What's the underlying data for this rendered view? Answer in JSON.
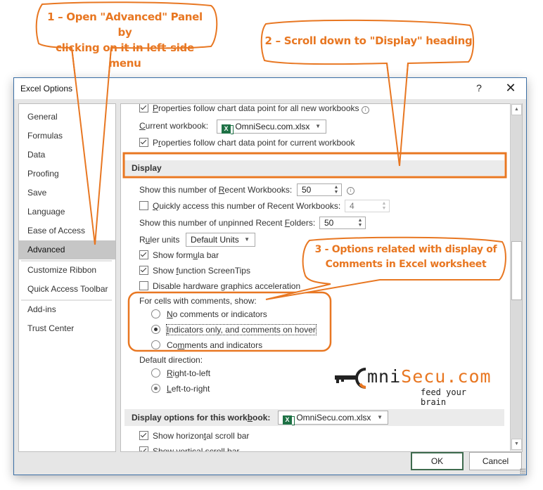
{
  "annotations": {
    "step1": [
      "1 – Open \"Advanced\" Panel by",
      "clicking on it in left-side menu"
    ],
    "step2": "2 – Scroll down to \"Display\" heading",
    "step3": [
      "3 - Options related with display of",
      "Comments in Excel worksheet"
    ],
    "color": "#e87722"
  },
  "dialog": {
    "title": "Excel Options",
    "help_label": "?",
    "close_label": "✕"
  },
  "sidebar": {
    "items": [
      {
        "label": "General"
      },
      {
        "label": "Formulas"
      },
      {
        "label": "Data"
      },
      {
        "label": "Proofing"
      },
      {
        "label": "Save"
      },
      {
        "label": "Language"
      },
      {
        "label": "Ease of Access"
      },
      {
        "label": "Advanced",
        "selected": true
      },
      {
        "label": "Customize Ribbon"
      },
      {
        "label": "Quick Access Toolbar"
      },
      {
        "label": "Add-ins"
      },
      {
        "label": "Trust Center"
      }
    ]
  },
  "content": {
    "chart_props_all": {
      "pre": "",
      "u": "P",
      "post": "roperties follow chart data point for all new workbooks",
      "checked": true
    },
    "current_workbook": {
      "label_u": "C",
      "label_post": "urrent workbook:",
      "value": "OmniSecu.com.xlsx"
    },
    "chart_props_current": {
      "pre": "P",
      "u": "r",
      "post": "operties follow chart data point for current workbook",
      "checked": true
    },
    "display_heading": "Display",
    "recent_workbooks": {
      "pre": "Show this number of ",
      "u": "R",
      "post": "ecent Workbooks:",
      "value": "50"
    },
    "quick_access": {
      "u": "Q",
      "post": "uickly access this number of Recent Workbooks:",
      "value": "4",
      "checked": false
    },
    "recent_folders": {
      "pre": "Show this number of unpinned Recent ",
      "u": "F",
      "post": "olders:",
      "value": "50"
    },
    "ruler_units": {
      "pre": "R",
      "u": "u",
      "post": "ler units",
      "value": "Default Units"
    },
    "formula_bar": {
      "pre": "Show form",
      "u": "u",
      "post": "la bar",
      "checked": true
    },
    "screentips": {
      "pre": "Show ",
      "u": "f",
      "post": "unction ScreenTips",
      "checked": true
    },
    "hw_accel": {
      "pre": "Disable hardware ",
      "u": "g",
      "post": "raphics acceleration",
      "checked": false
    },
    "comments_label": "For cells with comments, show:",
    "comments_options": [
      {
        "pre": "",
        "u": "N",
        "post": "o comments or indicators",
        "selected": false
      },
      {
        "pre": "",
        "u": "I",
        "post": "ndicators only, and comments on hover",
        "selected": true
      },
      {
        "pre": "Co",
        "u": "m",
        "post": "ments and indicators",
        "selected": false
      }
    ],
    "direction_label": "Default direction:",
    "direction_options": [
      {
        "u": "R",
        "post": "ight-to-left",
        "selected": false
      },
      {
        "u": "L",
        "post": "eft-to-right",
        "selected": true
      }
    ],
    "workbook_display_heading": {
      "pre": "Display options for this work",
      "u": "b",
      "post": "ook:",
      "value": "OmniSecu.com.xlsx"
    },
    "horizontal_scroll": {
      "pre": "Show horizon",
      "u": "t",
      "post": "al scroll bar",
      "checked": true
    },
    "vertical_scroll": {
      "label": "Show vertical scroll bar",
      "checked": true
    }
  },
  "logo": {
    "word_prefix": "mni",
    "word_suffix": "Secu.com",
    "tagline": "feed your brain"
  },
  "footer": {
    "ok_label": "OK",
    "cancel_label": "Cancel"
  }
}
